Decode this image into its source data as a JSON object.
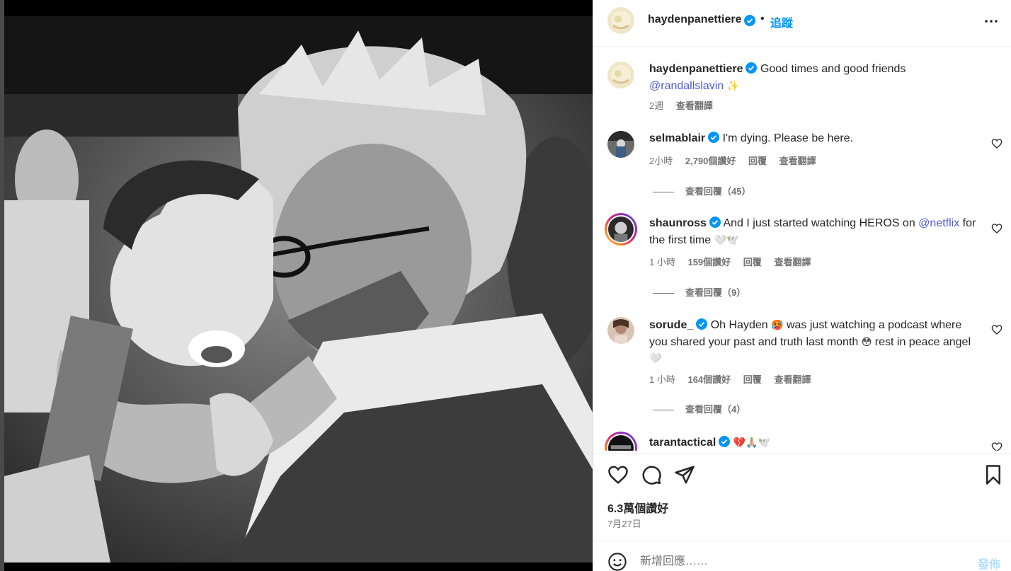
{
  "post": {
    "author": "haydenpanettiere",
    "follow_label": "追蹤",
    "separator": "•",
    "caption_text": "Good times and good friends",
    "caption_mention": "@randallslavin",
    "caption_emoji": "✨",
    "caption_age": "2週",
    "translate_label": "查看翻譯",
    "likes_label": "6.3萬個讚好",
    "date": "7月27日"
  },
  "comments": [
    {
      "user": "selmablair",
      "text": "I'm dying. Please be here.",
      "age": "2小時",
      "likes": "2,790個讚好",
      "reply_label": "回覆",
      "translate_label": "查看翻譯",
      "view_replies": "查看回覆（45）"
    },
    {
      "user": "shaunross",
      "text_before": "And I just started watching HEROS on ",
      "mention": "@netflix",
      "text_after": " for the first time",
      "emoji": "🤍🕊️",
      "age": "1 小時",
      "likes": "159個讚好",
      "reply_label": "回覆",
      "translate_label": "查看翻譯",
      "view_replies": "查看回覆（9）"
    },
    {
      "user": "sorude_",
      "text_a": "Oh Hayden",
      "emoji_a": "🥵",
      "text_b": " was just watching a podcast where you shared your past and truth last month",
      "emoji_b": "😳",
      "text_c": " rest in peace angel",
      "emoji_c": "🤍",
      "age": "1 小時",
      "likes": "164個讚好",
      "reply_label": "回覆",
      "translate_label": "查看翻譯",
      "view_replies": "查看回覆（4）"
    },
    {
      "user": "tarantactical",
      "emoji": "💔🙏🏼🕊️"
    }
  ],
  "add_comment": {
    "placeholder": "新增回應……",
    "post_label": "發佈"
  },
  "icons": {
    "like": "heart-icon",
    "comment": "comment-icon",
    "share": "send-icon",
    "save": "bookmark-icon",
    "emoji": "smiley-icon",
    "more": "more-icon",
    "verified": "verified-badge-icon"
  },
  "colors": {
    "link": "#0095f6",
    "mention": "#4f5bd5",
    "verified": "#0095f6",
    "muted": "#737373"
  }
}
